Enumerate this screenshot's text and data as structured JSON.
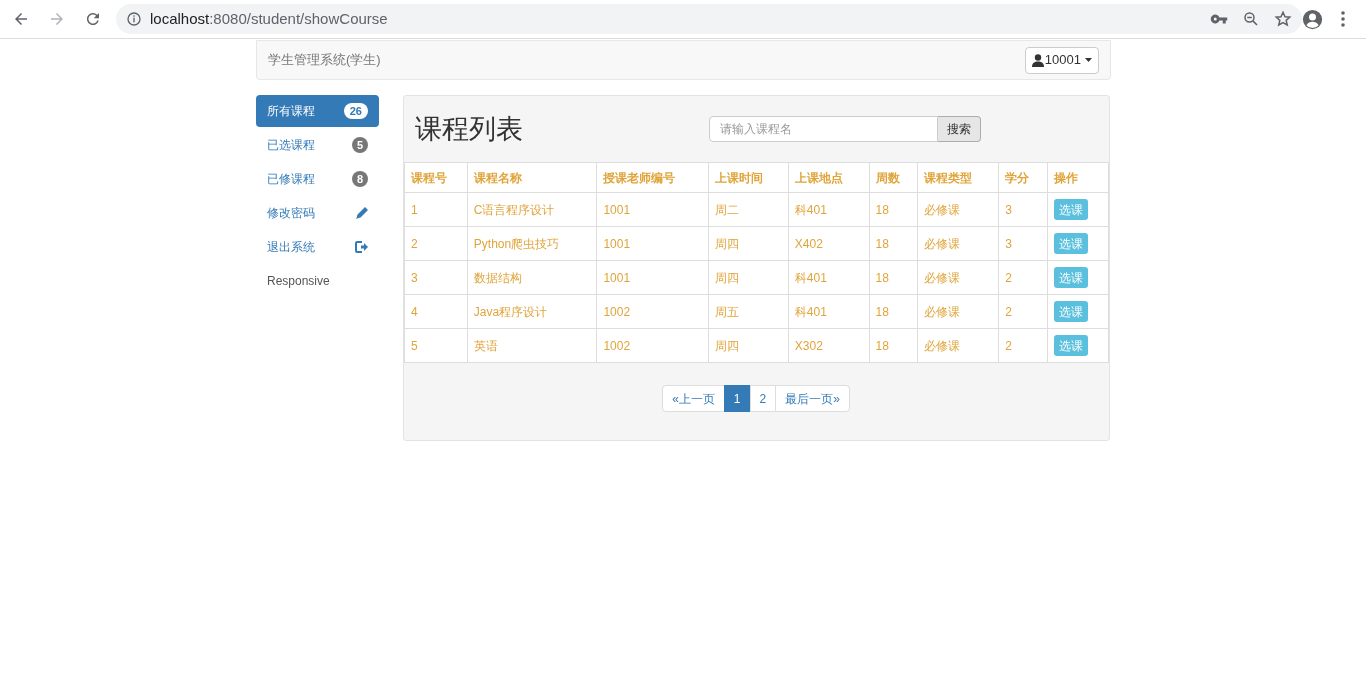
{
  "browser": {
    "url_host": "localhost",
    "url_path": ":8080/student/showCourse"
  },
  "navbar": {
    "title": "学生管理系统(学生)",
    "user_button": "10001"
  },
  "sidebar": {
    "items": [
      {
        "label": "所有课程",
        "kind": "badge",
        "badge": "26",
        "selected": true
      },
      {
        "label": "已选课程",
        "kind": "badge",
        "badge": "5",
        "selected": false
      },
      {
        "label": "已修课程",
        "kind": "badge",
        "badge": "8",
        "selected": false
      },
      {
        "label": "修改密码",
        "kind": "pencil",
        "selected": false
      },
      {
        "label": "退出系统",
        "kind": "logout",
        "selected": false
      },
      {
        "label": "Responsive",
        "kind": "plain",
        "selected": false
      }
    ]
  },
  "panel": {
    "title": "课程列表",
    "search": {
      "placeholder": "请输入课程名",
      "button": "搜索"
    }
  },
  "table": {
    "columns": [
      "课程号",
      "课程名称",
      "授课老师编号",
      "上课时间",
      "上课地点",
      "周数",
      "课程类型",
      "学分",
      "操作"
    ],
    "rows": [
      {
        "cells": [
          "1",
          "C语言程序设计",
          "1001",
          "周二",
          "科401",
          "18",
          "必修课",
          "3"
        ],
        "action": "选课"
      },
      {
        "cells": [
          "2",
          "Python爬虫技巧",
          "1001",
          "周四",
          "X402",
          "18",
          "必修课",
          "3"
        ],
        "action": "选课"
      },
      {
        "cells": [
          "3",
          "数据结构",
          "1001",
          "周四",
          "科401",
          "18",
          "必修课",
          "2"
        ],
        "action": "选课"
      },
      {
        "cells": [
          "4",
          "Java程序设计",
          "1002",
          "周五",
          "科401",
          "18",
          "必修课",
          "2"
        ],
        "action": "选课"
      },
      {
        "cells": [
          "5",
          "英语",
          "1002",
          "周四",
          "X302",
          "18",
          "必修课",
          "2"
        ],
        "action": "选课"
      }
    ]
  },
  "pagination": [
    {
      "label": "«上一页",
      "selected": false
    },
    {
      "label": "1",
      "selected": true
    },
    {
      "label": "2",
      "selected": false
    },
    {
      "label": "最后一页»",
      "selected": false
    }
  ]
}
